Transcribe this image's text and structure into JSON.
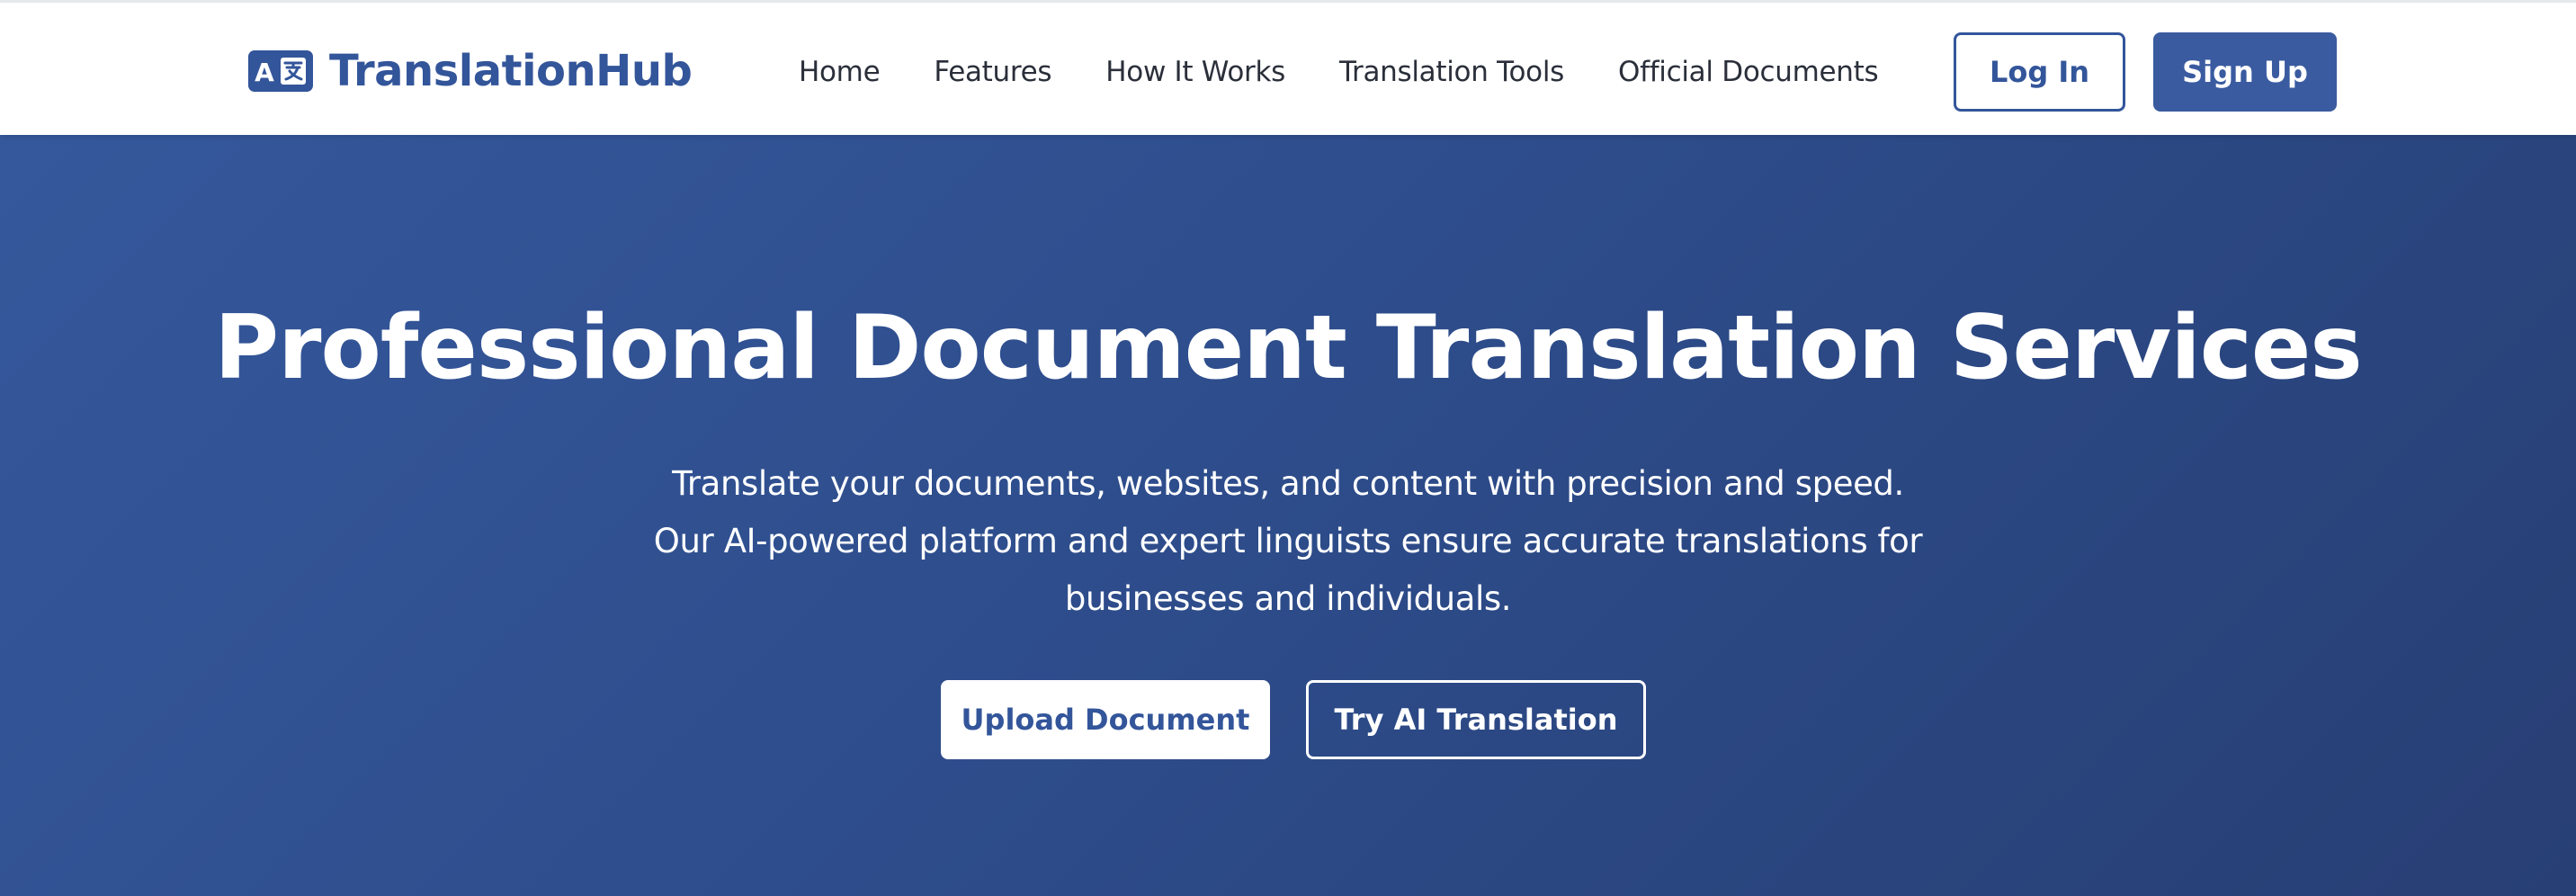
{
  "brand": {
    "name": "TranslationHub",
    "icon": "translate-icon",
    "color": "#33559a"
  },
  "nav": {
    "items": [
      {
        "label": "Home"
      },
      {
        "label": "Features"
      },
      {
        "label": "How It Works"
      },
      {
        "label": "Translation Tools"
      },
      {
        "label": "Official Documents"
      }
    ]
  },
  "auth": {
    "login_label": "Log In",
    "signup_label": "Sign Up"
  },
  "hero": {
    "title": "Professional Document Translation Services",
    "subtitle_lines": [
      "Translate your documents, websites, and content with precision and speed.",
      "Our AI-powered platform and expert linguists ensure accurate translations for",
      "businesses and individuals."
    ],
    "primary_cta": "Upload Document",
    "secondary_cta": "Try AI Translation"
  },
  "colors": {
    "accent": "#3a5ba0",
    "hero_gradient_start": "#35589c",
    "hero_gradient_end": "#273f74",
    "nav_text": "#2a2f3a"
  }
}
